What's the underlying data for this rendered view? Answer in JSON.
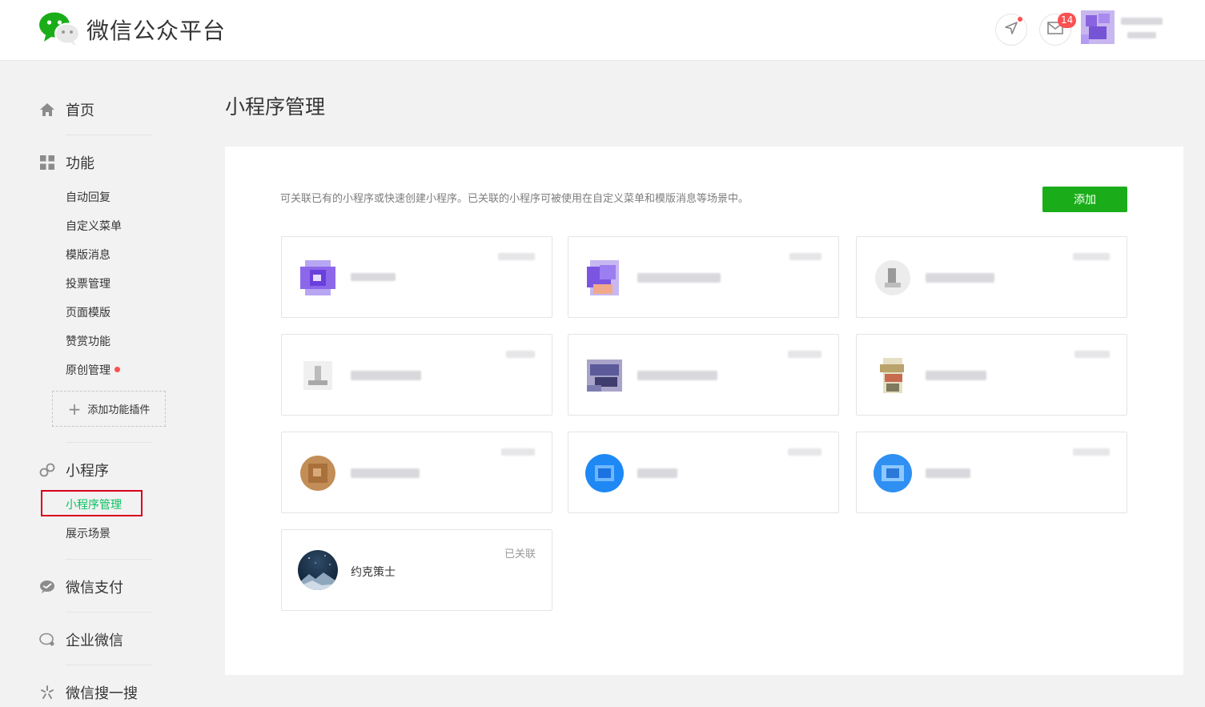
{
  "header": {
    "brand": "微信公众平台",
    "mail_badge": "14"
  },
  "sidebar": {
    "home": "首页",
    "functions": {
      "label": "功能",
      "items": [
        "自动回复",
        "自定义菜单",
        "模版消息",
        "投票管理",
        "页面模版",
        "赞赏功能",
        "原创管理"
      ],
      "add_plugin": "添加功能插件"
    },
    "miniprogram": {
      "label": "小程序",
      "items": [
        "小程序管理",
        "展示场景"
      ],
      "active": "小程序管理"
    },
    "wechat_pay": "微信支付",
    "work_wechat": "企业微信",
    "wechat_search": "微信搜一搜"
  },
  "main": {
    "title": "小程序管理",
    "description": "可关联已有的小程序或快速创建小程序。已关联的小程序可被使用在自定义菜单和模版消息等场景中。",
    "add_button": "添加",
    "visible_card": {
      "name": "约克策士",
      "status": "已关联"
    }
  },
  "colors": {
    "accent_green": "#07c160",
    "button_green": "#1aad19",
    "badge_red": "#fa5151",
    "highlight_red": "#d9001b"
  }
}
